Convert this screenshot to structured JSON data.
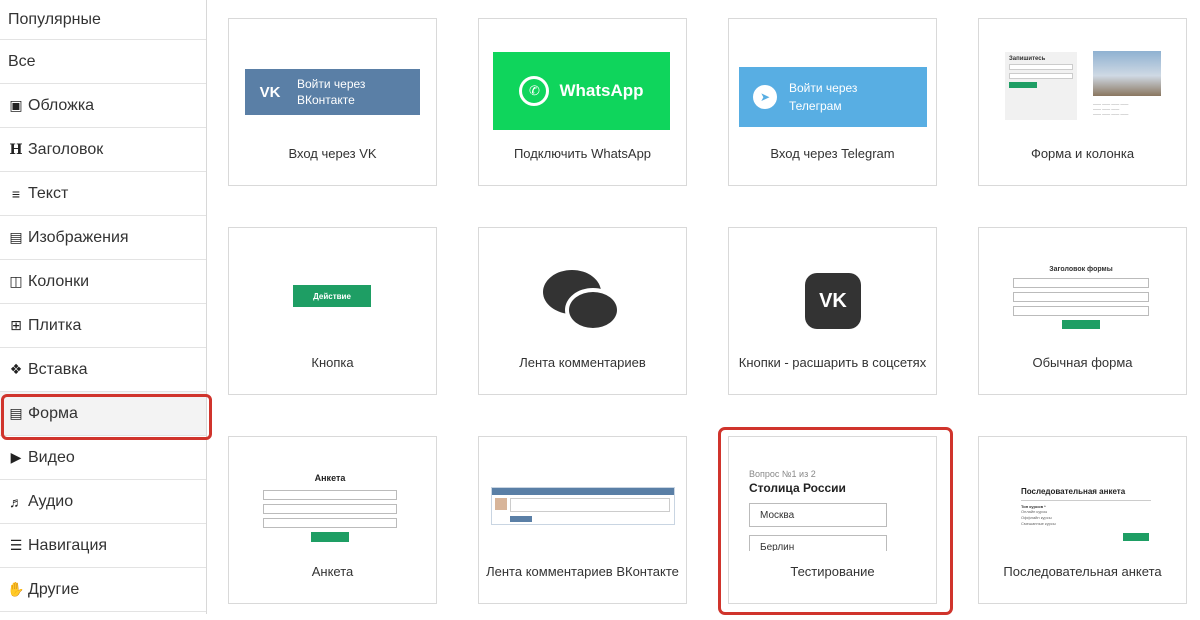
{
  "sidebar": {
    "items": [
      {
        "label": "Популярные",
        "icon": ""
      },
      {
        "label": "Все",
        "icon": ""
      },
      {
        "label": "Обложка",
        "icon": "camera-icon"
      },
      {
        "label": "Заголовок",
        "icon": "heading-icon"
      },
      {
        "label": "Текст",
        "icon": "text-lines-icon"
      },
      {
        "label": "Изображения",
        "icon": "image-icon"
      },
      {
        "label": "Колонки",
        "icon": "columns-icon"
      },
      {
        "label": "Плитка",
        "icon": "grid-icon"
      },
      {
        "label": "Вставка",
        "icon": "cubes-icon"
      },
      {
        "label": "Форма",
        "icon": "form-icon",
        "active": true
      },
      {
        "label": "Видео",
        "icon": "video-icon"
      },
      {
        "label": "Аудио",
        "icon": "audio-icon"
      },
      {
        "label": "Навигация",
        "icon": "menu-icon"
      },
      {
        "label": "Другие",
        "icon": "hand-icon"
      }
    ]
  },
  "cards": [
    {
      "label": "Вход через VK",
      "thumb": {
        "text": "Войти через ВКонтакте"
      }
    },
    {
      "label": "Подключить WhatsApp",
      "thumb": {
        "text": "WhatsApp"
      }
    },
    {
      "label": "Вход через Telegram",
      "thumb": {
        "text": "Войти через Телеграм"
      }
    },
    {
      "label": "Форма и колонка",
      "thumb": {
        "title": "Запишитесь"
      }
    },
    {
      "label": "Кнопка",
      "thumb": {
        "text": "Действие"
      }
    },
    {
      "label": "Лента комментариев"
    },
    {
      "label": "Кнопки - расшарить в соцсетях"
    },
    {
      "label": "Обычная форма",
      "thumb": {
        "title": "Заголовок формы"
      }
    },
    {
      "label": "Анкета",
      "thumb": {
        "title": "Анкета"
      }
    },
    {
      "label": "Лента комментариев ВКонтакте"
    },
    {
      "label": "Тестирование",
      "highlighted": true,
      "thumb": {
        "question": "Вопрос №1 из 2",
        "title": "Столица России",
        "options": [
          "Москва",
          "Берлин"
        ]
      }
    },
    {
      "label": "Последовательная анкета",
      "thumb": {
        "title": "Последовательная анкета",
        "subtitle": "Тип курсов *",
        "options": [
          "Онлайн курсы",
          "Оффлайн курсы",
          "Смешанные курсы"
        ]
      }
    }
  ],
  "colors": {
    "highlight": "#d0342c",
    "vk": "#5a7fa6",
    "whatsapp": "#0fd55c",
    "telegram": "#58aee3",
    "green_button": "#1e9e64"
  }
}
